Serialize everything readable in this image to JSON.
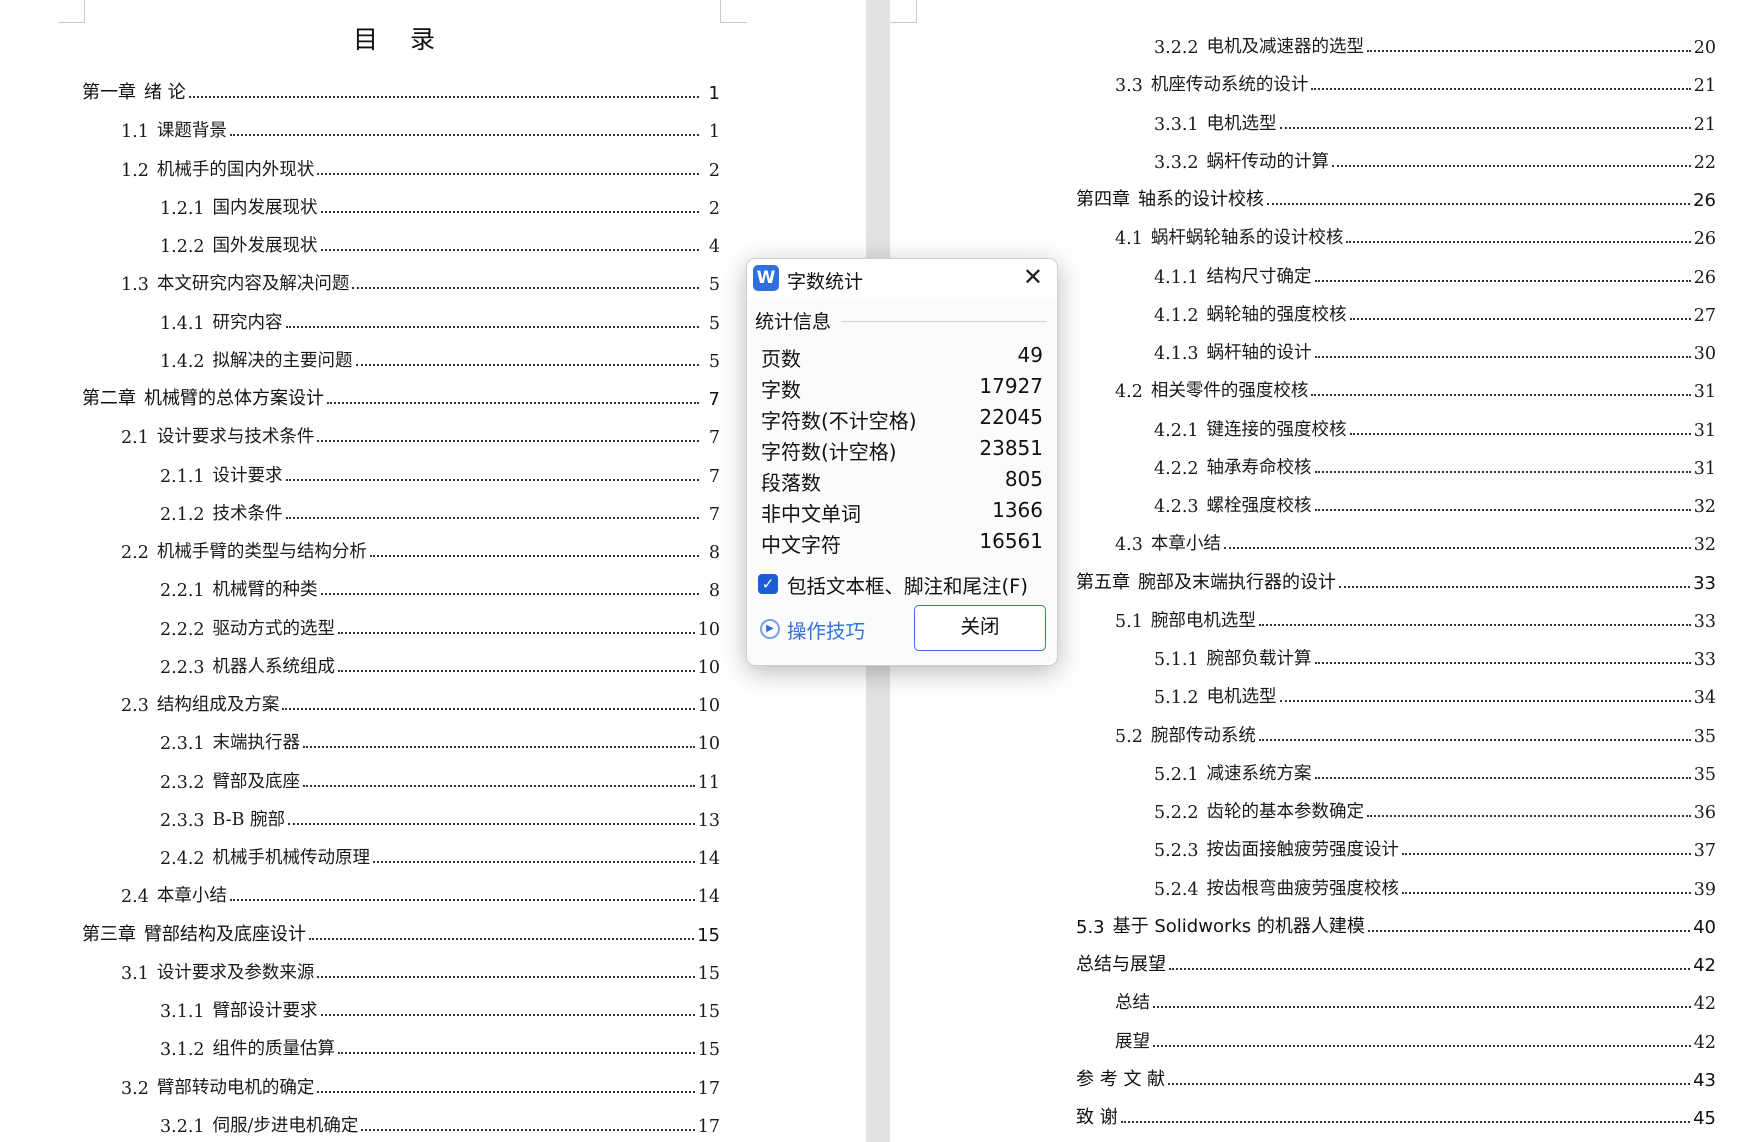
{
  "toc_title": "目 录",
  "left_entries": [
    {
      "num": "第一章",
      "title": "绪 论",
      "page": "1",
      "level": 0
    },
    {
      "num": "1.1",
      "title": "课题背景",
      "page": "1",
      "level": 1
    },
    {
      "num": "1.2",
      "title": "机械手的国内外现状",
      "page": "2",
      "level": 1
    },
    {
      "num": "1.2.1",
      "title": "国内发展现状",
      "page": "2",
      "level": 2
    },
    {
      "num": "1.2.2",
      "title": "国外发展现状",
      "page": "4",
      "level": 2
    },
    {
      "num": "1.3",
      "title": "本文研究内容及解决问题",
      "page": "5",
      "level": 1
    },
    {
      "num": "1.4.1",
      "title": "研究内容",
      "page": "5",
      "level": 2
    },
    {
      "num": "1.4.2",
      "title": "拟解决的主要问题",
      "page": "5",
      "level": 2
    },
    {
      "num": "第二章",
      "title": "机械臂的总体方案设计",
      "page": "7",
      "level": 0
    },
    {
      "num": "2.1",
      "title": "设计要求与技术条件",
      "page": "7",
      "level": 1
    },
    {
      "num": "2.1.1",
      "title": "设计要求",
      "page": "7",
      "level": 2
    },
    {
      "num": "2.1.2",
      "title": "技术条件",
      "page": "7",
      "level": 2
    },
    {
      "num": "2.2",
      "title": "机械手臂的类型与结构分析",
      "page": "8",
      "level": 1
    },
    {
      "num": "2.2.1",
      "title": "机械臂的种类",
      "page": "8",
      "level": 2
    },
    {
      "num": "2.2.2",
      "title": "驱动方式的选型",
      "page": "10",
      "level": 2
    },
    {
      "num": "2.2.3",
      "title": "机器人系统组成",
      "page": "10",
      "level": 2
    },
    {
      "num": "2.3",
      "title": "结构组成及方案",
      "page": "10",
      "level": 1
    },
    {
      "num": "2.3.1",
      "title": "末端执行器",
      "page": "10",
      "level": 2
    },
    {
      "num": "2.3.2",
      "title": "臂部及底座",
      "page": "11",
      "level": 2
    },
    {
      "num": "2.3.3",
      "title": "B-B 腕部",
      "page": "13",
      "level": 2
    },
    {
      "num": "2.4.2",
      "title": "机械手机械传动原理",
      "page": "14",
      "level": 2
    },
    {
      "num": "2.4",
      "title": "本章小结",
      "page": "14",
      "level": 1
    },
    {
      "num": "第三章",
      "title": "臂部结构及底座设计",
      "page": "15",
      "level": 0
    },
    {
      "num": "3.1",
      "title": "设计要求及参数来源",
      "page": "15",
      "level": 1
    },
    {
      "num": "3.1.1",
      "title": "臂部设计要求",
      "page": "15",
      "level": 2
    },
    {
      "num": "3.1.2",
      "title": "组件的质量估算",
      "page": "15",
      "level": 2
    },
    {
      "num": "3.2",
      "title": "臂部转动电机的确定",
      "page": "17",
      "level": 1
    },
    {
      "num": "3.2.1",
      "title": "伺服/步进电机确定",
      "page": "17",
      "level": 2
    }
  ],
  "right_entries": [
    {
      "num": "3.2.2",
      "title": "电机及减速器的选型",
      "page": "20",
      "level": 2
    },
    {
      "num": "3.3",
      "title": "机座传动系统的设计",
      "page": "21",
      "level": 1
    },
    {
      "num": "3.3.1",
      "title": "电机选型",
      "page": "21",
      "level": 2
    },
    {
      "num": "3.3.2",
      "title": "蜗杆传动的计算",
      "page": "22",
      "level": 2
    },
    {
      "num": "第四章",
      "title": "轴系的设计校核",
      "page": "26",
      "level": 0
    },
    {
      "num": "4.1",
      "title": "蜗杆蜗轮轴系的设计校核",
      "page": "26",
      "level": 1
    },
    {
      "num": "4.1.1",
      "title": "结构尺寸确定",
      "page": "26",
      "level": 2
    },
    {
      "num": "4.1.2",
      "title": "蜗轮轴的强度校核",
      "page": "27",
      "level": 2
    },
    {
      "num": "4.1.3",
      "title": "蜗杆轴的设计",
      "page": "30",
      "level": 2
    },
    {
      "num": "4.2",
      "title": "相关零件的强度校核",
      "page": "31",
      "level": 1
    },
    {
      "num": "4.2.1",
      "title": "键连接的强度校核",
      "page": "31",
      "level": 2
    },
    {
      "num": "4.2.2",
      "title": "轴承寿命校核",
      "page": "31",
      "level": 2
    },
    {
      "num": "4.2.3",
      "title": "螺栓强度校核",
      "page": "32",
      "level": 2
    },
    {
      "num": "4.3",
      "title": "本章小结",
      "page": "32",
      "level": 1
    },
    {
      "num": "第五章",
      "title": "腕部及末端执行器的设计",
      "page": "33",
      "level": 0
    },
    {
      "num": "5.1",
      "title": "腕部电机选型",
      "page": "33",
      "level": 1
    },
    {
      "num": "5.1.1",
      "title": "腕部负载计算",
      "page": "33",
      "level": 2
    },
    {
      "num": "5.1.2",
      "title": "电机选型",
      "page": "34",
      "level": 2
    },
    {
      "num": "5.2",
      "title": "腕部传动系统",
      "page": "35",
      "level": 1
    },
    {
      "num": "5.2.1",
      "title": "减速系统方案",
      "page": "35",
      "level": 2
    },
    {
      "num": "5.2.2",
      "title": "齿轮的基本参数确定",
      "page": "36",
      "level": 2
    },
    {
      "num": "5.2.3",
      "title": "按齿面接触疲劳强度设计",
      "page": "37",
      "level": 2
    },
    {
      "num": "5.2.4",
      "title": "按齿根弯曲疲劳强度校核",
      "page": "39",
      "level": 2
    },
    {
      "num": "5.3",
      "title": "基于 Solidworks 的机器人建模",
      "page": "40",
      "level": 0
    },
    {
      "num": "",
      "title": "总结与展望",
      "page": "42",
      "level": 0
    },
    {
      "num": "",
      "title": "总结",
      "page": "42",
      "level": 1
    },
    {
      "num": "",
      "title": "展望",
      "page": "42",
      "level": 1
    },
    {
      "num": "",
      "title": "参 考 文 献",
      "page": "43",
      "level": 0
    },
    {
      "num": "",
      "title": "致 谢",
      "page": "45",
      "level": 0
    }
  ],
  "dialog": {
    "title": "字数统计",
    "app_icon": "W",
    "close_glyph": "✕",
    "section": "统计信息",
    "stats": [
      {
        "label": "页数",
        "value": "49"
      },
      {
        "label": "字数",
        "value": "17927"
      },
      {
        "label": "字符数(不计空格)",
        "value": "22045"
      },
      {
        "label": "字符数(计空格)",
        "value": "23851"
      },
      {
        "label": "段落数",
        "value": "805"
      },
      {
        "label": "非中文单词",
        "value": "1366"
      },
      {
        "label": "中文字符",
        "value": "16561"
      }
    ],
    "checkbox_label": "包括文本框、脚注和尾注(F)",
    "checkbox_checked": true,
    "tips_label": "操作技巧",
    "close_button": "关闭",
    "accent_color": "#1e5bd6"
  }
}
